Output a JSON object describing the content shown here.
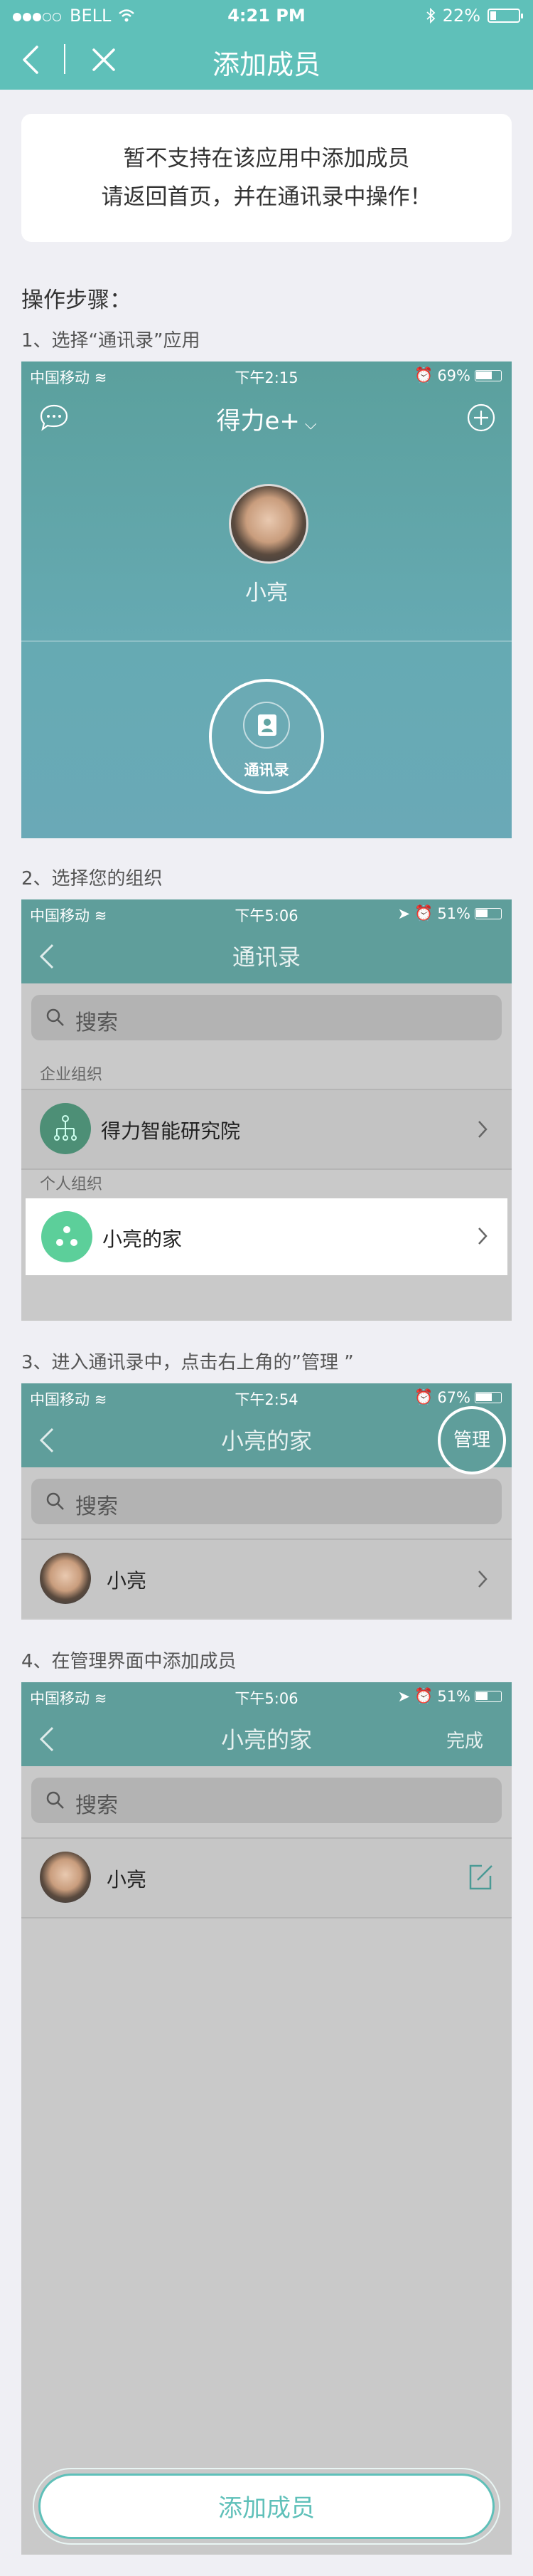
{
  "status_bar": {
    "carrier": "BELL",
    "time": "4:21 PM",
    "battery": "22%"
  },
  "nav": {
    "title": "添加成员",
    "back_icon": "chevron-left-icon",
    "close_icon": "close-icon"
  },
  "notice": {
    "line1": "暂不支持在该应用中添加成员",
    "line2": "请返回首页，并在通讯录中操作！"
  },
  "steps_heading": "操作步骤：",
  "steps": [
    {
      "label": "1、选择“通讯录”应用",
      "screen": {
        "carrier": "中国移动",
        "time": "下午2:15",
        "battery": "69%",
        "app_title": "得力e+",
        "user_name": "小亮",
        "contacts_button": "通讯录"
      }
    },
    {
      "label": "2、选择您的组织",
      "screen": {
        "carrier": "中国移动",
        "time": "下午5:06",
        "battery": "51%",
        "title": "通讯录",
        "search_placeholder": "搜索",
        "section_enterprise": "企业组织",
        "enterprise_org": "得力智能研究院",
        "section_personal": "个人组织",
        "personal_org": "小亮的家"
      }
    },
    {
      "label": "3、进入通讯录中，点击右上角的”管理 ”",
      "screen": {
        "carrier": "中国移动",
        "time": "下午2:54",
        "battery": "67%",
        "title": "小亮的家",
        "manage_button": "管理",
        "search_placeholder": "搜索",
        "member_name": "小亮"
      }
    },
    {
      "label": "4、在管理界面中添加成员",
      "screen": {
        "carrier": "中国移动",
        "time": "下午5:06",
        "battery": "51%",
        "title": "小亮的家",
        "done_button": "完成",
        "search_placeholder": "搜索",
        "member_name": "小亮",
        "add_member_button": "添加成员"
      }
    }
  ],
  "colors": {
    "brand": "#5fc0b9",
    "screen_teal": "#62a5a3",
    "overlay_gray": "#c8c8c8"
  }
}
